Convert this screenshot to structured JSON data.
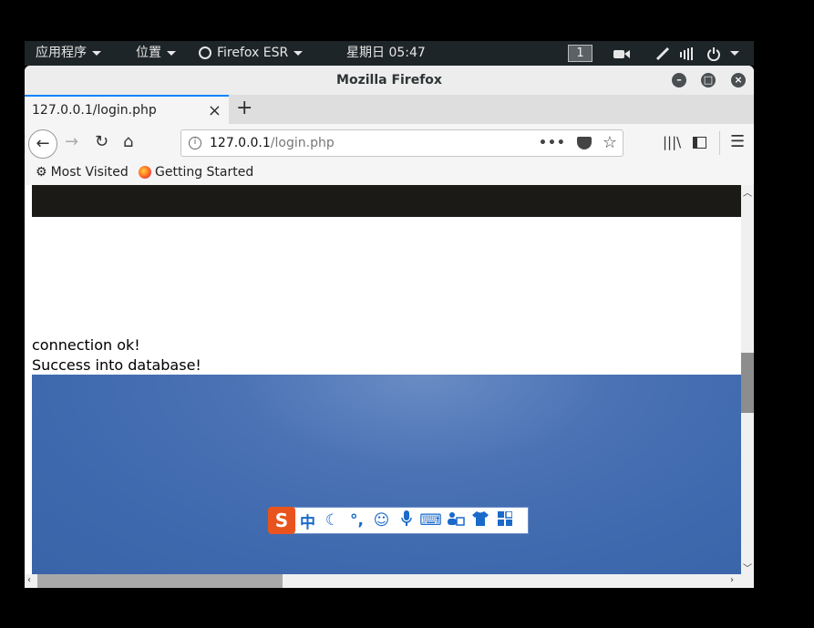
{
  "topbar": {
    "applications": "应用程序",
    "places": "位置",
    "app_name": "Firefox ESR",
    "clock": "星期日 05:47",
    "workspace": "1"
  },
  "window": {
    "title": "Mozilla Firefox"
  },
  "tab": {
    "title": "127.0.0.1/login.php"
  },
  "urlbar": {
    "host": "127.0.0.1",
    "path": "/login.php"
  },
  "bookmarks": {
    "most_visited": "Most Visited",
    "getting_started": "Getting Started"
  },
  "content": {
    "line1": "connection ok!",
    "line2": "Success into database!"
  },
  "ime": {
    "logo": "S",
    "mode": "中"
  }
}
